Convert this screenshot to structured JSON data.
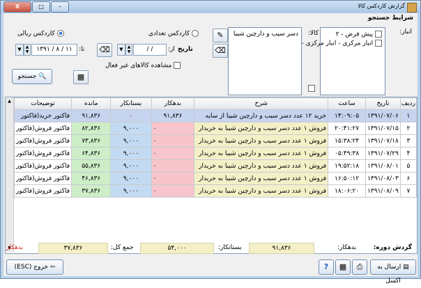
{
  "window": {
    "title": "گزارش کاردکس کالا",
    "close": "X",
    "min": "–",
    "max": "□"
  },
  "search": {
    "section_title": "شرایط جستجو",
    "warehouse_label": "انبار:",
    "warehouses": [
      "پیش فرض - ۲",
      "انبار مرکزی - انبار مرکزی -"
    ],
    "goods_label": "کالا:",
    "goods_value": "دسر سیب و دارچین شیبا",
    "cardex_qty": "کاردکس تعدادی",
    "cardex_rial": "کاردکس ریالی",
    "date_label": "تاریخ",
    "from_label": "از:",
    "to_label": "تا:",
    "from_value": "/ /",
    "to_value": "۱۳۹۱ / ۸ / ۱۱",
    "inactive": "مشاهده کالاهای غیر فعال",
    "search_button": "جستجو"
  },
  "grid": {
    "columns": [
      "ردیف",
      "تاریخ",
      "ساعت",
      "شرح",
      "بدهکار",
      "بستانکار",
      "مانده",
      "توضیحات"
    ],
    "rows": [
      [
        "۱",
        "۱۳۹۱/۰۷/۰۶",
        "۱۴:۰۹:۰۵",
        "خرید ۱۲ عدد دسر سیب و دارچین شیبا از سایه",
        "۹۱,۸۳۶",
        "۰",
        "۹۱,۸۳۶",
        "فاکتور خرید(فاکتور"
      ],
      [
        "۲",
        "۱۳۹۱/۰۷/۱۵",
        "۲۰:۴۱:۲۷",
        "فروش ۱ عدد دسر سیب و دارچین شیبا به خریدار",
        "۰",
        "۹,۰۰۰",
        "۸۲,۸۳۶",
        "فاکتور فروش(فاکتور"
      ],
      [
        "۳",
        "۱۳۹۱/۰۷/۱۸",
        "۱۵:۳۸:۲۴",
        "فروش ۱ عدد دسر سیب و دارچین شیبا به خریدار",
        "۰",
        "۹,۰۰۰",
        "۷۳,۸۳۶",
        "فاکتور فروش(فاکتور"
      ],
      [
        "۴",
        "۱۳۹۱/۰۷/۲۹",
        "۰۵:۴۹:۳۸",
        "فروش ۱ عدد دسر سیب و دارچین شیبا به خریدار",
        "۰",
        "۹,۰۰۰",
        "۶۴,۸۳۶",
        "فاکتور فروش(فاکتور"
      ],
      [
        "۵",
        "۱۳۹۱/۰۸/۰۱",
        "۱۹:۵۲:۱۸",
        "فروش ۱ عدد دسر سیب و دارچین شیبا به خریدار",
        "۰",
        "۹,۰۰۰",
        "۵۵,۸۳۶",
        "فاکتور فروش(فاکتور"
      ],
      [
        "۶",
        "۱۳۹۱/۰۸/۰۳",
        "۱۶:۵۰:۱۲",
        "فروش ۱ عدد دسر سیب و دارچین شیبا به خریدار",
        "۰",
        "۹,۰۰۰",
        "۴۶,۸۳۶",
        "فاکتور فروش(فاکتور"
      ],
      [
        "۷",
        "۱۳۹۱/۰۸/۰۹",
        "۱۸:۰۶:۲۰",
        "فروش ۱ عدد دسر سیب و دارچین شیبا به خریدار",
        "۰",
        "۹,۰۰۰",
        "۳۷,۸۳۶",
        "فاکتور فروش(فاکتور"
      ]
    ]
  },
  "footer": {
    "period_label": "گردش دوره:",
    "debit_label": "بدهکار:",
    "debit_value": "۹۱,۸۳۶",
    "credit_label": "بستانکار:",
    "credit_value": "۵۴,۰۰۰",
    "total_label": "جمع کل:",
    "total_value": "۳۷,۸۳۶",
    "status": "بدهکار",
    "status_color": "#e03020",
    "excel_button": "ارسال به اکسل",
    "exit_button": "خروج (ESC)"
  }
}
